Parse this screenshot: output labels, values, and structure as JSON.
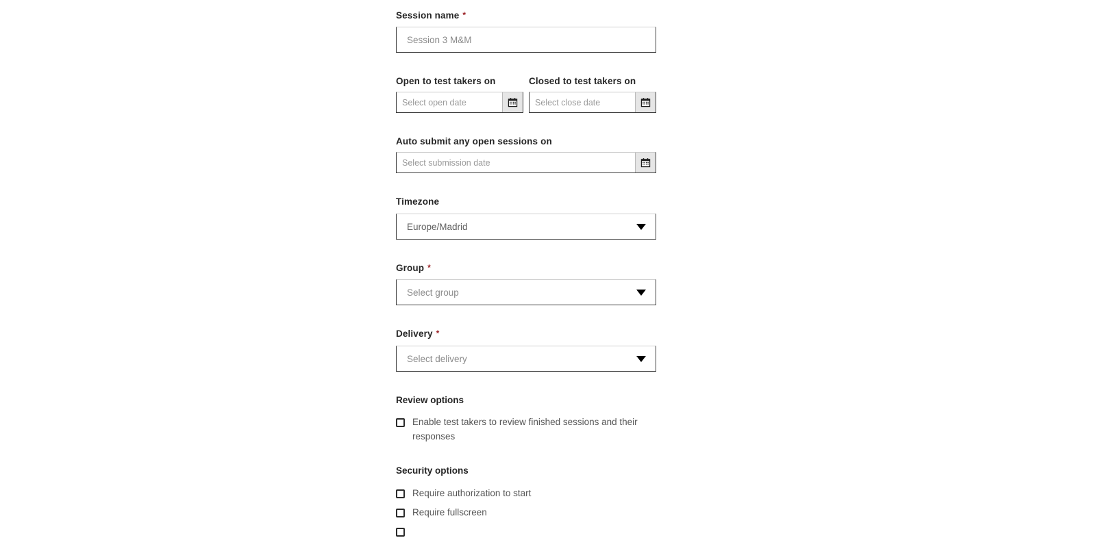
{
  "form": {
    "session_name": {
      "label": "Session name",
      "required": true,
      "required_marker": "*",
      "placeholder": "Session 3 M&M",
      "value": ""
    },
    "open_date": {
      "label": "Open to test takers on",
      "placeholder": "Select open date",
      "value": "",
      "icon": "calendar-icon"
    },
    "close_date": {
      "label": "Closed to test takers on",
      "placeholder": "Select close date",
      "value": "",
      "icon": "calendar-icon"
    },
    "auto_submit": {
      "label": "Auto submit any open sessions on",
      "placeholder": "Select submission date",
      "value": "",
      "icon": "calendar-icon"
    },
    "timezone": {
      "label": "Timezone",
      "required": false,
      "selected": "Europe/Madrid",
      "icon": "chevron-down-icon"
    },
    "group": {
      "label": "Group",
      "required": true,
      "required_marker": "*",
      "selected": "Select group",
      "icon": "chevron-down-icon"
    },
    "delivery": {
      "label": "Delivery",
      "required": true,
      "required_marker": "*",
      "selected": "Select delivery",
      "icon": "chevron-down-icon"
    },
    "review_options": {
      "heading": "Review options",
      "items": [
        {
          "label": "Enable test takers to review finished sessions and their responses",
          "checked": false
        }
      ]
    },
    "security_options": {
      "heading": "Security options",
      "items": [
        {
          "label": "Require authorization to start",
          "checked": false
        },
        {
          "label": "Require fullscreen",
          "checked": false
        },
        {
          "label": "",
          "checked": false
        }
      ]
    }
  },
  "colors": {
    "label_text": "#252525",
    "required_asterisk": "#9b2226",
    "placeholder_text": "#8a8a8a",
    "value_text": "#5f5f5f",
    "checkbox_border": "#2b2b2b",
    "input_border": "#3d3d3d",
    "calendar_button_bg": "#e6e6e6",
    "background": "#ffffff"
  }
}
